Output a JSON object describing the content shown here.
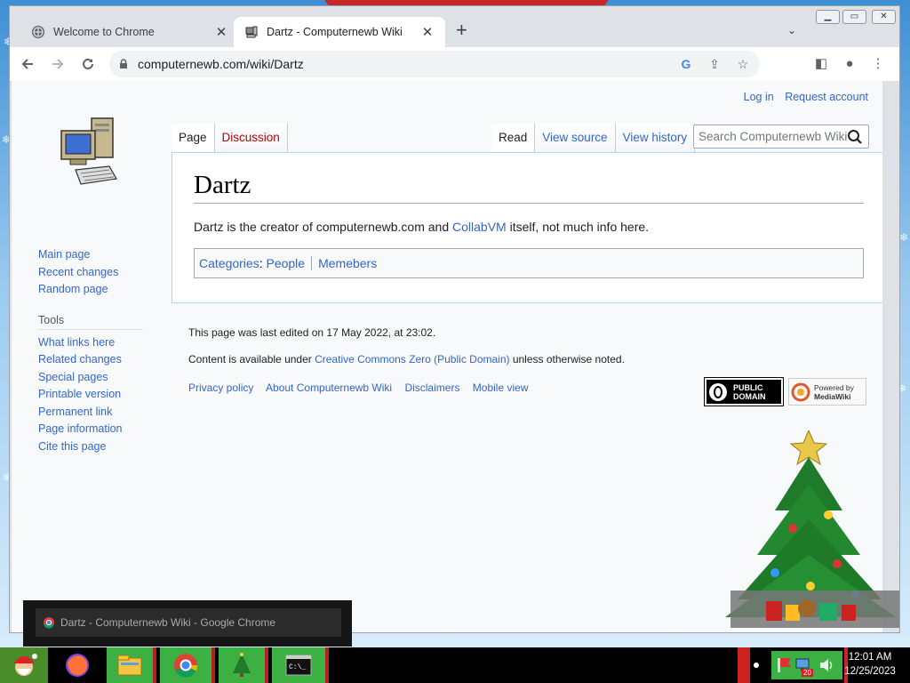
{
  "browser": {
    "tabs": [
      {
        "title": "Welcome to Chrome",
        "active": false
      },
      {
        "title": "Dartz - Computernewb Wiki",
        "active": true
      }
    ],
    "url": "computernewb.com/wiki/Dartz",
    "icons": {
      "back": "arrow-left-icon",
      "forward": "arrow-right-icon",
      "reload": "reload-icon",
      "lock": "lock-icon",
      "google": "google-icon",
      "share": "share-icon",
      "bookmark": "star-icon",
      "sidepanel": "side-panel-icon",
      "profile": "profile-icon",
      "menu": "kebab-menu-icon"
    }
  },
  "wiki": {
    "personal": {
      "login": "Log in",
      "request": "Request account"
    },
    "sidebar": {
      "nav": [
        "Main page",
        "Recent changes",
        "Random page"
      ],
      "tools_heading": "Tools",
      "tools": [
        "What links here",
        "Related changes",
        "Special pages",
        "Printable version",
        "Permanent link",
        "Page information",
        "Cite this page"
      ]
    },
    "tabs": {
      "page": "Page",
      "discussion": "Discussion",
      "read": "Read",
      "view_source": "View source",
      "view_history": "View history"
    },
    "search_placeholder": "Search Computernewb Wiki",
    "title": "Dartz",
    "body": {
      "prefix": "Dartz is the creator of computernewb.com and ",
      "link": "CollabVM",
      "suffix": " itself, not much info here."
    },
    "categories": {
      "label": "Categories",
      "items": [
        "People",
        "Memebers"
      ]
    },
    "footer": {
      "last_edited": "This page was last edited on 17 May 2022, at 23:02.",
      "license_prefix": "Content is available under ",
      "license_link": "Creative Commons Zero (Public Domain)",
      "license_suffix": " unless otherwise noted.",
      "links": [
        "Privacy policy",
        "About Computernewb Wiki",
        "Disclaimers",
        "Mobile view"
      ],
      "badge_pd": [
        "PUBLIC",
        "DOMAIN"
      ],
      "badge_mw": [
        "Powered by",
        "MediaWiki"
      ]
    }
  },
  "taskbar": {
    "thumbnail_title": "Dartz - Computernewb Wiki - Google Chrome",
    "time": "12:01 AM",
    "date": "12/25/2023",
    "notification_count": "20"
  },
  "colors": {
    "link": "#3366cc",
    "red_link": "#ba0000",
    "taskbar_green": "#3cb043"
  }
}
